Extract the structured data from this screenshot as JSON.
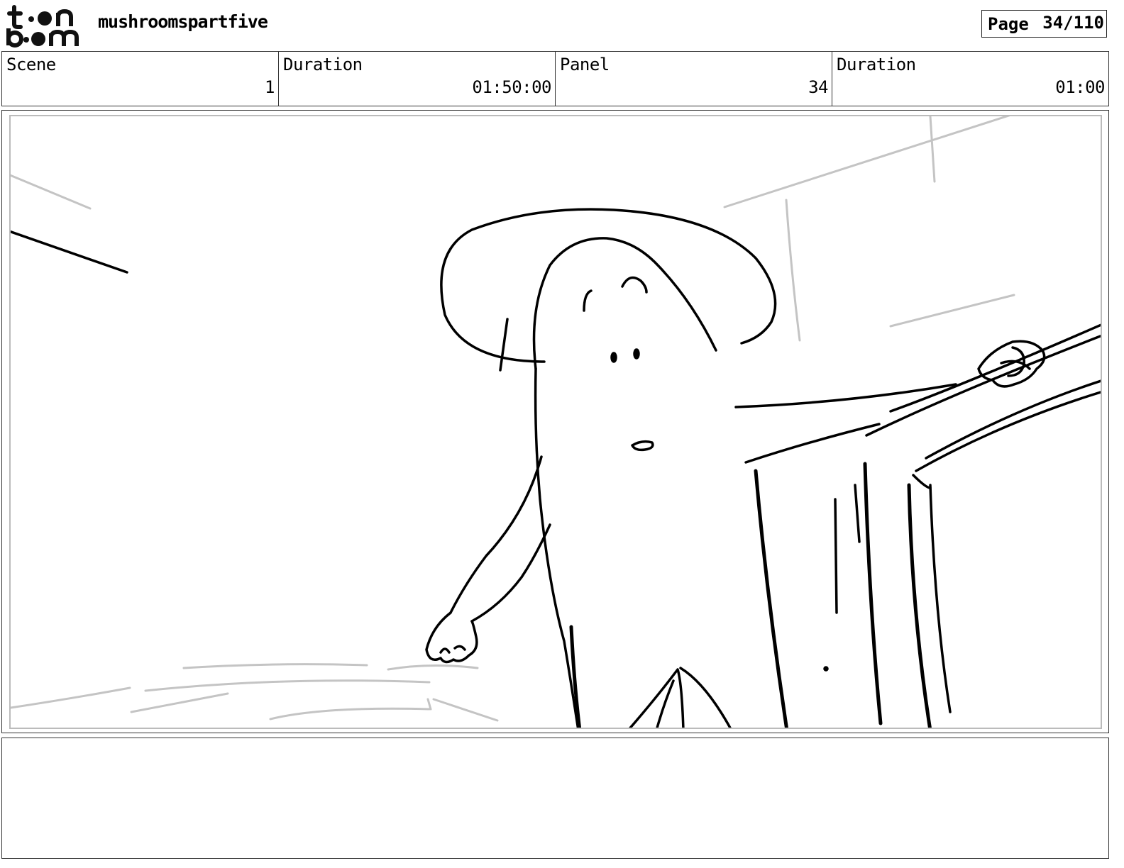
{
  "header": {
    "logo_text": "toonboom",
    "project_title": "mushroomspartfive",
    "page_label": "Page",
    "page_number": "34/110"
  },
  "info": {
    "scene_label": "Scene",
    "scene_value": "1",
    "scene_duration_label": "Duration",
    "scene_duration_value": "01:50:00",
    "panel_label": "Panel",
    "panel_value": "34",
    "panel_duration_label": "Duration",
    "panel_duration_value": "01:00"
  },
  "panel": {
    "image_icon": "storyboard-sketch-mushroom-character-at-wooden-rail"
  },
  "notes": {
    "text": ""
  }
}
